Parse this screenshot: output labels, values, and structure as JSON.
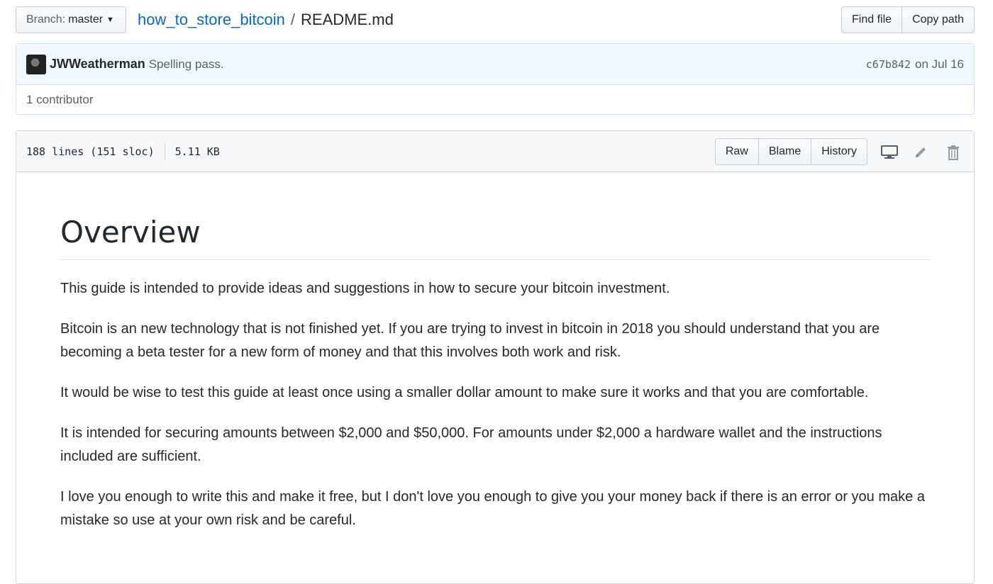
{
  "topbar": {
    "branch_prefix": "Branch:",
    "branch_name": "master",
    "repo": "how_to_store_bitcoin",
    "separator": "/",
    "file": "README.md",
    "find_file": "Find file",
    "copy_path": "Copy path"
  },
  "commit": {
    "author": "JWWeatherman",
    "message": "Spelling pass.",
    "sha": "c67b842",
    "date": "on Jul 16",
    "contributors": "1 contributor"
  },
  "file": {
    "lines": "188 lines (151 sloc)",
    "size": "5.11 KB",
    "raw": "Raw",
    "blame": "Blame",
    "history": "History"
  },
  "content": {
    "heading": "Overview",
    "paragraphs": [
      "This guide is intended to provide ideas and suggestions in how to secure your bitcoin investment.",
      "Bitcoin is an new technology that is not finished yet. If you are trying to invest in bitcoin in 2018 you should understand that you are becoming a beta tester for a new form of money and that this involves both work and risk.",
      "It would be wise to test this guide at least once using a smaller dollar amount to make sure it works and that you are comfortable.",
      "It is intended for securing amounts between $2,000 and $50,000. For amounts under $2,000 a hardware wallet and the instructions included are sufficient.",
      "I love you enough to write this and make it free, but I don't love you enough to give you your money back if there is an error or you make a mistake so use at your own risk and be careful."
    ]
  },
  "icons": {
    "desktop": "desktop-icon",
    "edit": "pencil-icon",
    "delete": "trash-icon",
    "caret": "caret-down-icon"
  },
  "colors": {
    "link": "#0366d6",
    "commit_bg": "#f1f8ff",
    "commit_border": "#c8e1ff",
    "header_bg": "#f6f8fa"
  }
}
